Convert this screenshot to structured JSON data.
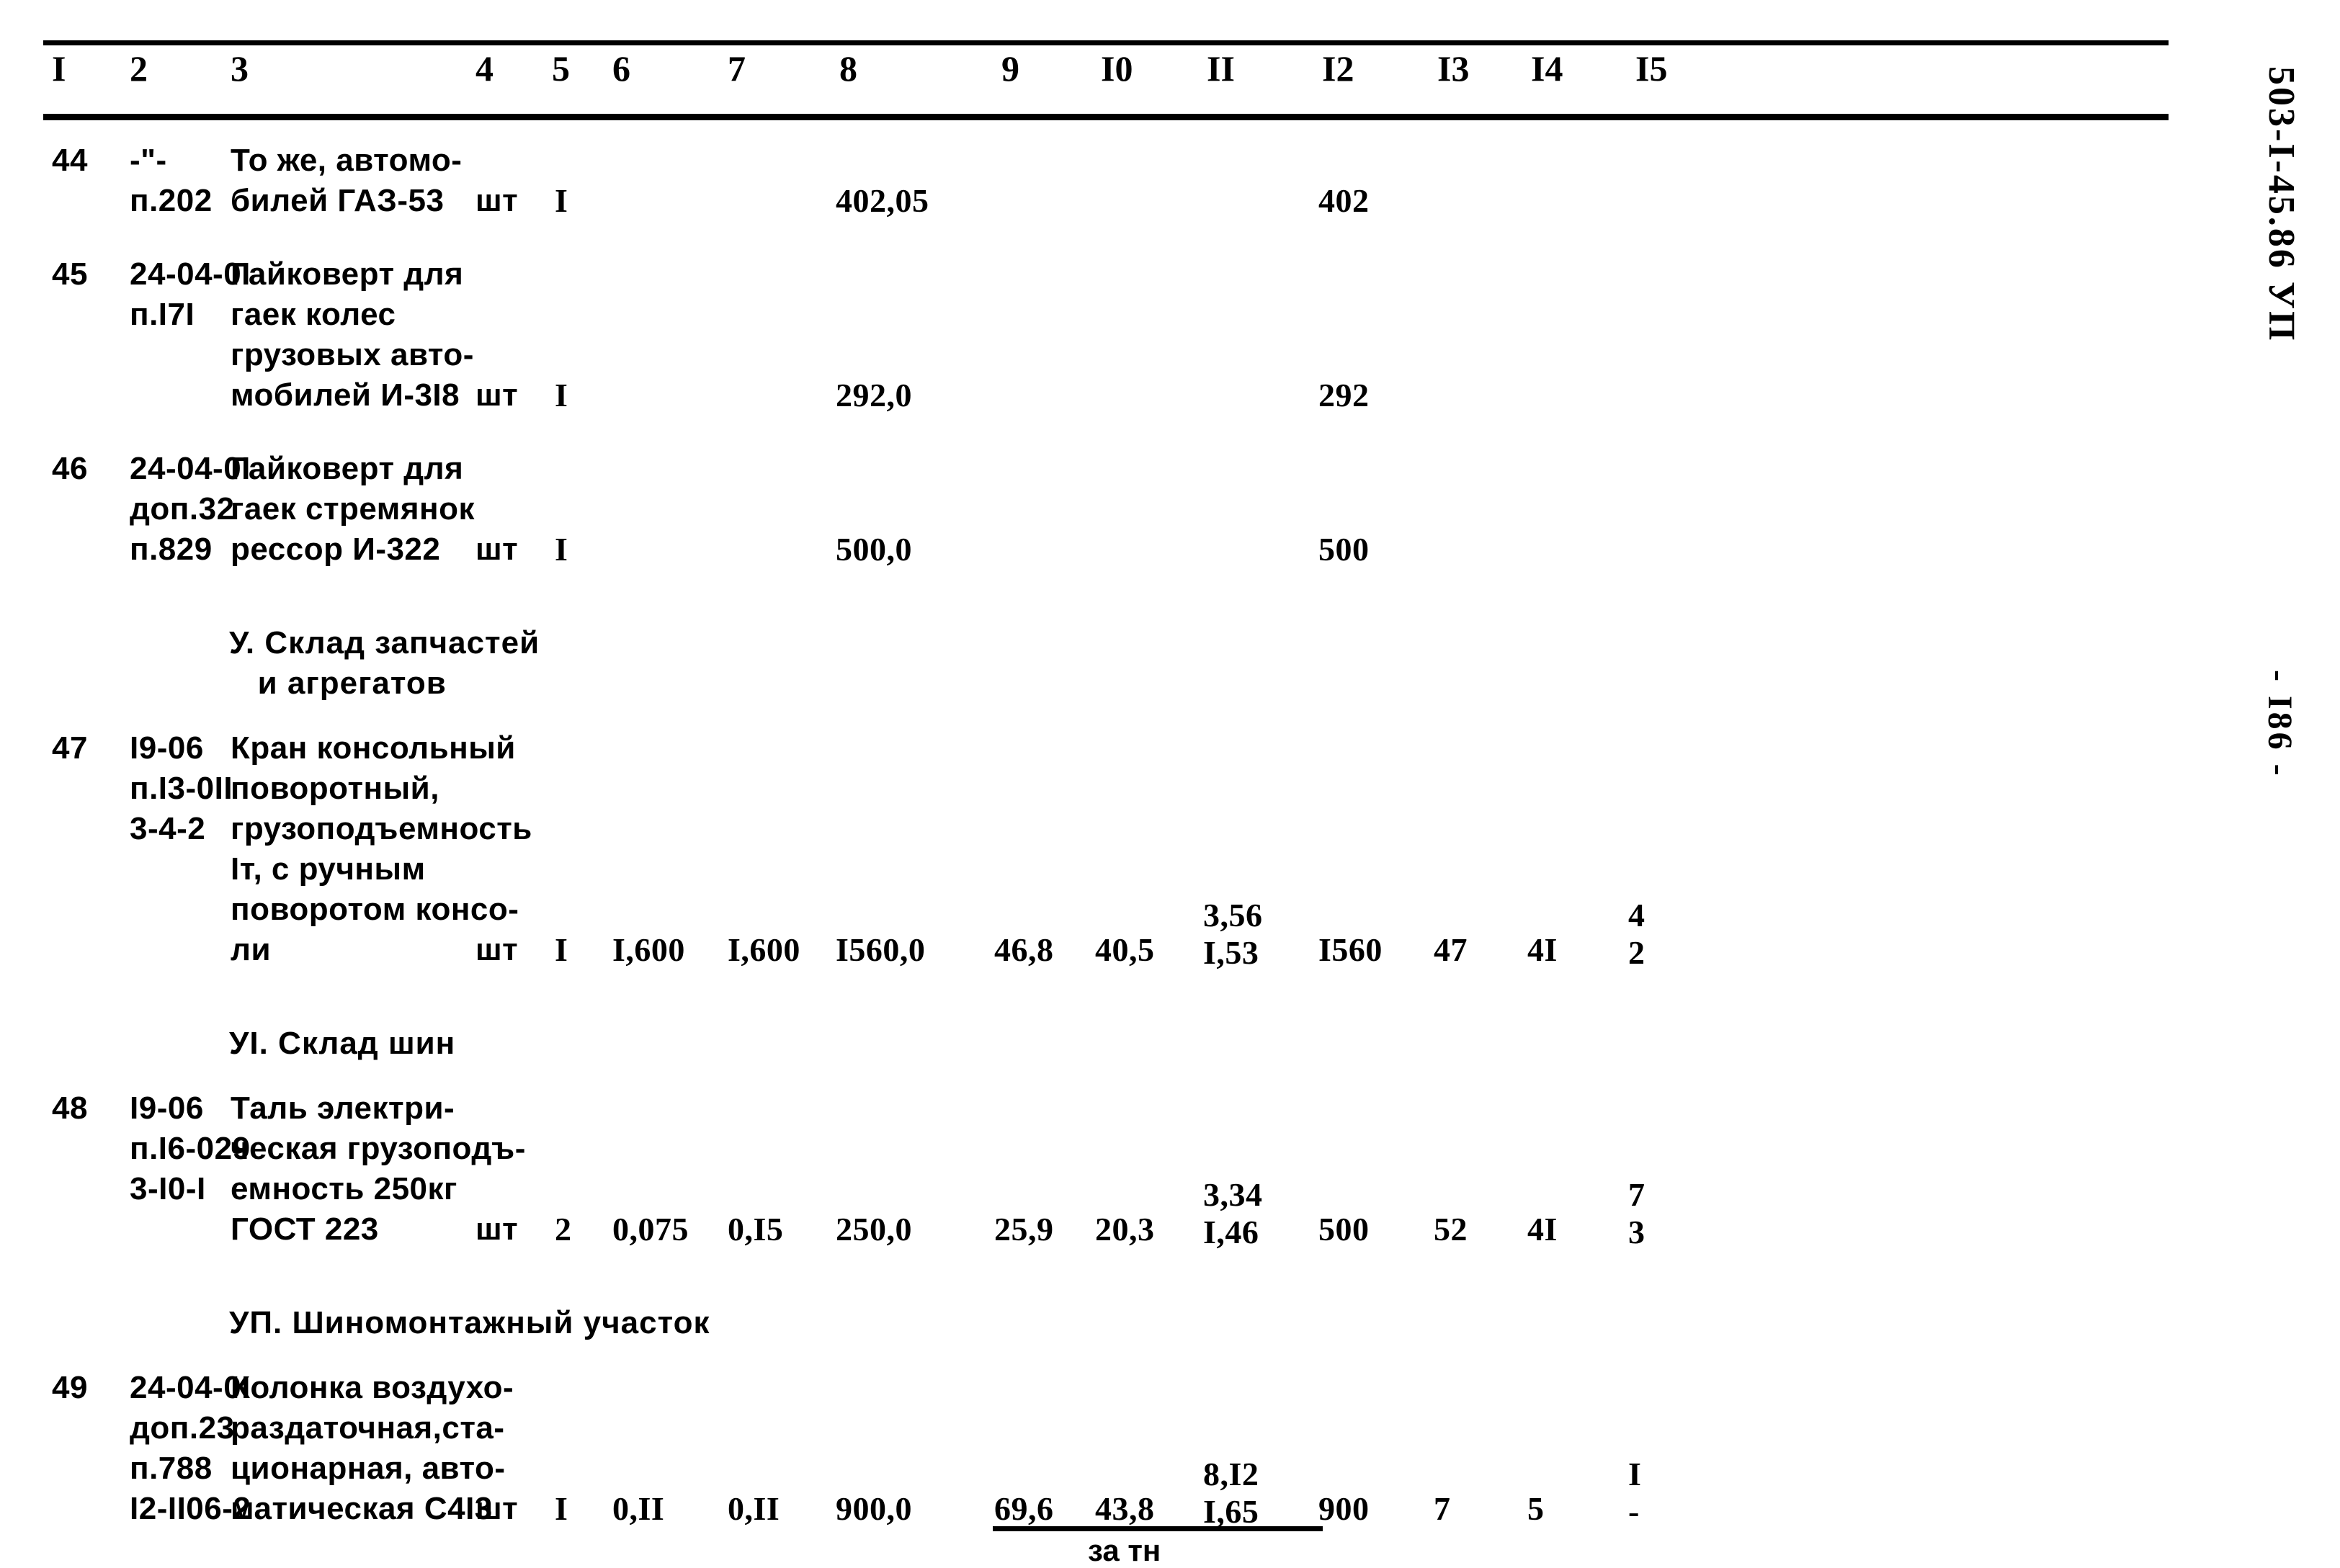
{
  "document": {
    "code": "503-I-45.86  УП",
    "page_label": "- I86 -"
  },
  "table": {
    "column_headers": [
      "I",
      "2",
      "3",
      "4",
      "5",
      "6",
      "7",
      "8",
      "9",
      "I0",
      "II",
      "I2",
      "I3",
      "I4",
      "I5"
    ],
    "rows": [
      {
        "kind": "data",
        "c1": "44",
        "c2": "-\"-\nп.202",
        "c3": "То же, автомо-\nбилей ГАЗ-53",
        "c4": "шт",
        "c5": "I",
        "c6": "",
        "c7": "",
        "c8": "402,05",
        "c9": "",
        "c10": "",
        "c11_top": "",
        "c11_bot": "",
        "c12": "402",
        "c13": "",
        "c14": "",
        "c15_top": "",
        "c15_bot": ""
      },
      {
        "kind": "data",
        "c1": "45",
        "c2": "24-04-0I\nп.I7I",
        "c3": "Гайковерт для\nгаек колес\nгрузовых авто-\nмобилей И-3I8",
        "c4": "шт",
        "c5": "I",
        "c6": "",
        "c7": "",
        "c8": "292,0",
        "c9": "",
        "c10": "",
        "c11_top": "",
        "c11_bot": "",
        "c12": "292",
        "c13": "",
        "c14": "",
        "c15_top": "",
        "c15_bot": ""
      },
      {
        "kind": "data",
        "c1": "46",
        "c2": "24-04-0I\nдоп.32\nп.829",
        "c3": "Гайковерт для\nгаек стремянок\nрессор И-322",
        "c4": "шт",
        "c5": "I",
        "c6": "",
        "c7": "",
        "c8": "500,0",
        "c9": "",
        "c10": "",
        "c11_top": "",
        "c11_bot": "",
        "c12": "500",
        "c13": "",
        "c14": "",
        "c15_top": "",
        "c15_bot": ""
      },
      {
        "kind": "section",
        "text": "У. Склад запчастей\n   и агрегатов"
      },
      {
        "kind": "data",
        "c1": "47",
        "c2": "I9-06\nп.I3-0II\n3-4-2",
        "c3": "Кран консольный\nповоротный,\nгрузоподъемность\nIт, с ручным\nповоротом консо-\nли",
        "c4": "шт",
        "c5": "I",
        "c6": "I,600",
        "c7": "I,600",
        "c8": "I560,0",
        "c9": "46,8",
        "c10": "40,5",
        "c11_top": "3,56",
        "c11_bot": "I,53",
        "c12": "I560",
        "c13": "47",
        "c14": "4I",
        "c15_top": "4",
        "c15_bot": "2"
      },
      {
        "kind": "section",
        "text": "УI. Склад шин"
      },
      {
        "kind": "data",
        "c1": "48",
        "c2": "I9-06\nп.I6-029\n3-I0-I",
        "c3": "Таль электри-\nческая грузоподъ-\nемность 250кг\nГОСТ 223",
        "c4": "шт",
        "c5": "2",
        "c6": "0,075",
        "c7": "0,I5",
        "c8": "250,0",
        "c9": "25,9",
        "c10": "20,3",
        "c11_top": "3,34",
        "c11_bot": "I,46",
        "c12": "500",
        "c13": "52",
        "c14": "4I",
        "c15_top": "7",
        "c15_bot": "3"
      },
      {
        "kind": "section",
        "text": "УП. Шиномонтажный участок"
      },
      {
        "kind": "data",
        "c1": "49",
        "c2": "24-04-0I\nдоп.23\nп.788\nI2-II06-2",
        "c3": "Колонка воздухо-\nраздаточная,ста-\nционарная, авто-\nматическая С4I3",
        "c4": "шт",
        "c5": "I",
        "c6": "0,II",
        "c7": "0,II",
        "c8": "900,0",
        "c9": "69,6",
        "c10": "43,8",
        "c11_top": "8,I2",
        "c11_bot": "I,65",
        "c12": "900",
        "c13": "7",
        "c14": "5",
        "c15_top": "I",
        "c15_bot": "-",
        "note": "за тн"
      }
    ]
  }
}
